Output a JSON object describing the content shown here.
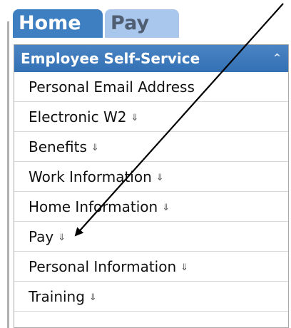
{
  "tabs": [
    {
      "label": "Home",
      "active": true
    },
    {
      "label": "Pay",
      "active": false
    }
  ],
  "panel": {
    "title": "Employee Self-Service",
    "collapse_icon": "^",
    "items": [
      {
        "label": "Personal Email Address",
        "has_chevron": false
      },
      {
        "label": "Electronic W2",
        "has_chevron": true
      },
      {
        "label": "Benefits",
        "has_chevron": true
      },
      {
        "label": "Work Information",
        "has_chevron": true
      },
      {
        "label": "Home Information",
        "has_chevron": true
      },
      {
        "label": "Pay",
        "has_chevron": true
      },
      {
        "label": "Personal Information",
        "has_chevron": true
      },
      {
        "label": "Training",
        "has_chevron": true
      }
    ],
    "chevron_glyph": "⇓"
  },
  "colors": {
    "tab_active": "#3d7fc1",
    "tab_inactive": "#a9c6ec",
    "header": "#3a78ba",
    "annotation_arrow": "#000000"
  },
  "icons": {
    "collapse": "chevron-up-icon",
    "item_expand": "double-down-arrow-icon",
    "annotation": "arrow-pointer-icon"
  }
}
